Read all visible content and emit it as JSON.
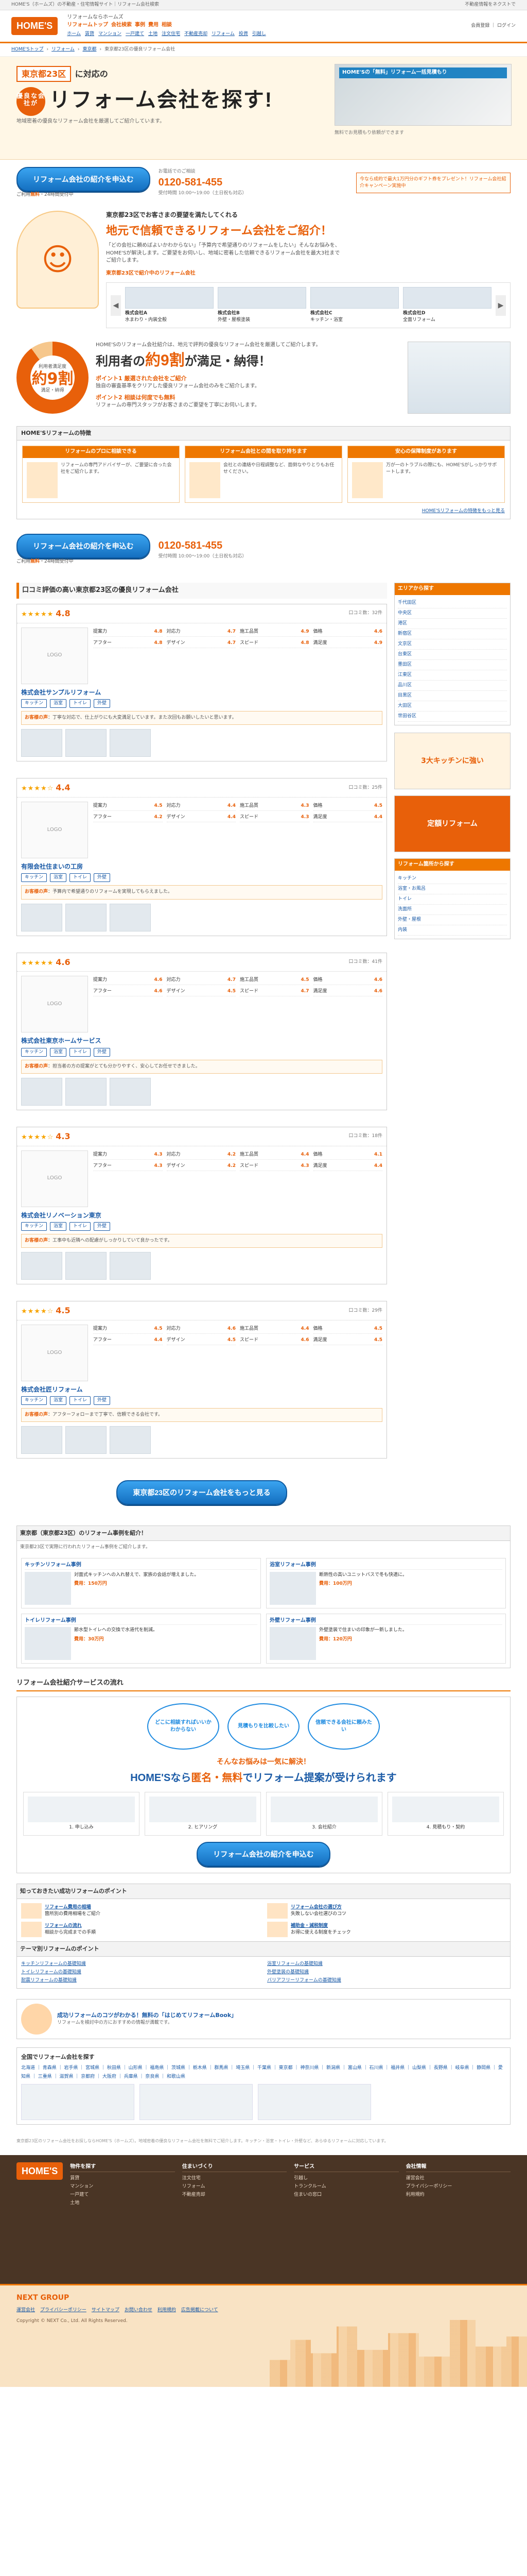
{
  "topstrip": {
    "left": "HOME'S（ホームズ）の不動産・住宅情報サイト｜リフォーム会社検索",
    "right": "不動産情報をネクストで"
  },
  "header": {
    "logo": "HOME'S",
    "sitename": "リフォームならホームズ",
    "nav": [
      "リフォームトップ",
      "会社検索",
      "事例",
      "費用",
      "相談"
    ],
    "subnav": [
      "ホーム",
      "賃貸",
      "マンション",
      "一戸建て",
      "土地",
      "注文住宅",
      "不動産売却",
      "リフォーム",
      "投資",
      "引越し"
    ],
    "right": "会員登録 ｜ ログイン"
  },
  "breadcrumb": [
    "HOME'Sトップ",
    "リフォーム",
    "東京都",
    "東京都23区の優良リフォーム会社"
  ],
  "hero": {
    "tag": "東京都23区",
    "tag_suffix": "に対応の",
    "badge": "優良な会社が",
    "title": "リフォーム会社を探す!",
    "sub": "地域密着の優良なリフォーム会社を厳選してご紹介しています。",
    "photo_caption": "HOME'Sの「無料」リフォーム一括見積もり",
    "pr": "無料でお見積もり依頼ができます"
  },
  "cta": {
    "button": "リフォーム会社の紹介を申込む",
    "free_prefix": "ご利用",
    "free": "無料",
    "free_suffix": "・24時間受付中",
    "tel_label": "お電話でのご相談",
    "tel": "0120-581-455",
    "tel_note": "受付時間 10:00〜19:00（土日祝も対応）",
    "campaign": "今なら成約で最大1万円分のギフト券をプレゼント！リフォーム会社紹介キャンペーン実施中"
  },
  "intro": {
    "lead": "東京都23区でお客さまの要望を満たしてくれる",
    "title": "地元で信頼できるリフォーム会社をご紹介！",
    "text": "「どの会社に頼めばよいかわからない」「予算内で希望通りのリフォームをしたい」そんなお悩みを、HOME'Sが解決します。ご要望をお伺いし、地域に密着した信頼できるリフォーム会社を最大3社までご紹介します。",
    "carousel_title": "東京都23区で紹介中のリフォーム会社",
    "carousel": [
      {
        "name": "株式会社A",
        "desc": "水まわり・内装全般"
      },
      {
        "name": "株式会社B",
        "desc": "外壁・屋根塗装"
      },
      {
        "name": "株式会社C",
        "desc": "キッチン・浴室"
      },
      {
        "name": "株式会社D",
        "desc": "全面リフォーム"
      }
    ]
  },
  "satis": {
    "lead": "HOME'Sのリフォーム会社紹介は、地元で評判の優良なリフォーム会社を厳選してご紹介します。",
    "h_prefix": "利用者の",
    "h_num": "約9割",
    "h_suffix": "が満足・納得！",
    "pie_label": "利用者満足度",
    "pie_value": "約9割",
    "pie_note": "満足・納得",
    "points": [
      {
        "title": "ポイント1 厳選された会社をご紹介",
        "text": "独自の審査基準をクリアした優良リフォーム会社のみをご紹介します。"
      },
      {
        "title": "ポイント2 相談は何度でも無料",
        "text": "リフォームの専門スタッフがお客さまのご要望を丁寧にお伺いします。"
      }
    ]
  },
  "features": {
    "head": "HOME'Sリフォームの特徴",
    "cols": [
      {
        "h": "リフォームのプロに相談できる",
        "t": "リフォームの専門アドバイザーが、ご要望に合った会社をご紹介します。"
      },
      {
        "h": "リフォーム会社との間を取り持ちます",
        "t": "会社との連絡や日程調整など、面倒なやりとりもお任せください。"
      },
      {
        "h": "安心の保障制度があります",
        "t": "万が一のトラブルの際にも、HOME'Sがしっかりサポートします。"
      }
    ],
    "more": "HOME'Sリフォームの特徴をもっと見る"
  },
  "companies": {
    "title": "口コミ評価の高い東京都23区の優良リフォーム会社",
    "info_label": "口コミ数",
    "rating_labels": [
      "提案力",
      "対応力",
      "施工品質",
      "価格",
      "アフター",
      "デザイン",
      "スピード",
      "満足度"
    ],
    "tags": [
      "キッチン",
      "浴室",
      "トイレ",
      "外壁"
    ],
    "rev_label": "お客様の声",
    "items": [
      {
        "stars": "★★★★★",
        "score": "4.8",
        "reviews": "32件",
        "name": "株式会社サンプルリフォーム",
        "ratings": [
          "4.8",
          "4.7",
          "4.9",
          "4.6",
          "4.8",
          "4.7",
          "4.8",
          "4.9"
        ],
        "review": "丁寧な対応で、仕上がりにも大変満足しています。また次回もお願いしたいと思います。"
      },
      {
        "stars": "★★★★☆",
        "score": "4.4",
        "reviews": "25件",
        "name": "有限会社住まいの工房",
        "ratings": [
          "4.5",
          "4.4",
          "4.3",
          "4.5",
          "4.2",
          "4.4",
          "4.3",
          "4.4"
        ],
        "review": "予算内で希望通りのリフォームを実現してもらえました。"
      },
      {
        "stars": "★★★★★",
        "score": "4.6",
        "reviews": "41件",
        "name": "株式会社東京ホームサービス",
        "ratings": [
          "4.6",
          "4.7",
          "4.5",
          "4.6",
          "4.6",
          "4.5",
          "4.7",
          "4.6"
        ],
        "review": "担当者の方の提案がとても分かりやすく、安心してお任せできました。"
      },
      {
        "stars": "★★★★☆",
        "score": "4.3",
        "reviews": "18件",
        "name": "株式会社リノベーション東京",
        "ratings": [
          "4.3",
          "4.2",
          "4.4",
          "4.1",
          "4.3",
          "4.2",
          "4.3",
          "4.4"
        ],
        "review": "工事中も近隣への配慮がしっかりしていて良かったです。"
      },
      {
        "stars": "★★★★☆",
        "score": "4.5",
        "reviews": "29件",
        "name": "株式会社匠リフォーム",
        "ratings": [
          "4.5",
          "4.6",
          "4.4",
          "4.5",
          "4.4",
          "4.5",
          "4.6",
          "4.5"
        ],
        "review": "アフターフォローまで丁寧で、信頼できる会社です。"
      }
    ],
    "more": "東京都23区のリフォーム会社をもっと見る"
  },
  "side": {
    "search_h": "エリアから探す",
    "areas": [
      "千代田区",
      "中央区",
      "港区",
      "新宿区",
      "文京区",
      "台東区",
      "墨田区",
      "江東区",
      "品川区",
      "目黒区",
      "大田区",
      "世田谷区"
    ],
    "banner1": "3大キッチンに強い",
    "banner2": "定額リフォーム",
    "cat_h": "リフォーム箇所から探す",
    "cats": [
      "キッチン",
      "浴室・お風呂",
      "トイレ",
      "洗面所",
      "外壁・屋根",
      "内装"
    ]
  },
  "cases": {
    "head": "東京都（東京都23区）のリフォーム事例を紹介！",
    "lead": "東京都23区で実際に行われたリフォーム事例をご紹介します。",
    "items": [
      {
        "t": "キッチンリフォーム事例",
        "d": "対面式キッチンへの入れ替えで、家族の会話が増えました。",
        "price": "費用：150万円"
      },
      {
        "t": "浴室リフォーム事例",
        "d": "断熱性の高いユニットバスで冬も快適に。",
        "price": "費用：100万円"
      },
      {
        "t": "トイレリフォーム事例",
        "d": "節水型トイレへの交換で水道代を削減。",
        "price": "費用：30万円"
      },
      {
        "t": "外壁リフォーム事例",
        "d": "外壁塗装で住まいの印象が一新しました。",
        "price": "費用：120万円"
      }
    ]
  },
  "flow": {
    "head": "リフォーム会社紹介サービスの流れ",
    "bubbles": [
      "どこに相談すればいいかわからない",
      "見積もりを比較したい",
      "信頼できる会社に頼みたい"
    ],
    "mid": "そんなお悩みは一気に解決！",
    "big_prefix": "HOME'Sなら",
    "big_em": "匿名・無料",
    "big_suffix": "でリフォーム提案が受けられます",
    "steps": [
      "1. 申し込み",
      "2. ヒアリング",
      "3. 会社紹介",
      "4. 見積もり・契約"
    ]
  },
  "know": {
    "head": "知っておきたい成功リフォームのポイント",
    "items": [
      {
        "t": "リフォーム費用の相場",
        "d": "箇所別の費用相場をご紹介"
      },
      {
        "t": "リフォーム会社の選び方",
        "d": "失敗しない会社選びのコツ"
      },
      {
        "t": "リフォームの流れ",
        "d": "相談から完成までの手順"
      },
      {
        "t": "補助金・減税制度",
        "d": "お得に使える制度をチェック"
      }
    ],
    "links_h": "テーマ別リフォームのポイント",
    "links": [
      "キッチンリフォームの基礎知識",
      "浴室リフォームの基礎知識",
      "トイレリフォームの基礎知識",
      "外壁塗装の基礎知識",
      "耐震リフォームの基礎知識",
      "バリアフリーリフォームの基礎知識"
    ]
  },
  "promo": {
    "t": "成功リフォームのコツがわかる！無料の「はじめてリフォームBook」",
    "d": "リフォームを検討中の方におすすめの情報が満載です。"
  },
  "areas": {
    "h": "全国でリフォーム会社を探す",
    "list": "北海道 ｜ 青森県 ｜ 岩手県 ｜ 宮城県 ｜ 秋田県 ｜ 山形県 ｜ 福島県 ｜ 茨城県 ｜ 栃木県 ｜ 群馬県 ｜ 埼玉県 ｜ 千葉県 ｜ 東京都 ｜ 神奈川県 ｜ 新潟県 ｜ 富山県 ｜ 石川県 ｜ 福井県 ｜ 山梨県 ｜ 長野県 ｜ 岐阜県 ｜ 静岡県 ｜ 愛知県 ｜ 三重県 ｜ 滋賀県 ｜ 京都府 ｜ 大阪府 ｜ 兵庫県 ｜ 奈良県 ｜ 和歌山県"
  },
  "seo": "東京都23区のリフォーム会社をお探しならHOME'S（ホームズ）。地域密着の優良なリフォーム会社を無料でご紹介します。キッチン・浴室・トイレ・外壁など、あらゆるリフォームに対応しています。",
  "footer": {
    "logo": "HOME'S",
    "cols": [
      {
        "h": "物件を探す",
        "items": [
          "賃貸",
          "マンション",
          "一戸建て",
          "土地"
        ]
      },
      {
        "h": "住まいづくり",
        "items": [
          "注文住宅",
          "リフォーム",
          "不動産売却"
        ]
      },
      {
        "h": "サービス",
        "items": [
          "引越し",
          "トランクルーム",
          "住まいの窓口"
        ]
      },
      {
        "h": "会社情報",
        "items": [
          "運営会社",
          "プライバシーポリシー",
          "利用規約"
        ]
      }
    ],
    "logo2": "NEXT GROUP",
    "links": [
      "運営会社",
      "プライバシーポリシー",
      "サイトマップ",
      "お問い合わせ",
      "利用規約",
      "広告掲載について"
    ],
    "copyright": "Copyright © NEXT Co., Ltd. All Rights Reserved."
  }
}
